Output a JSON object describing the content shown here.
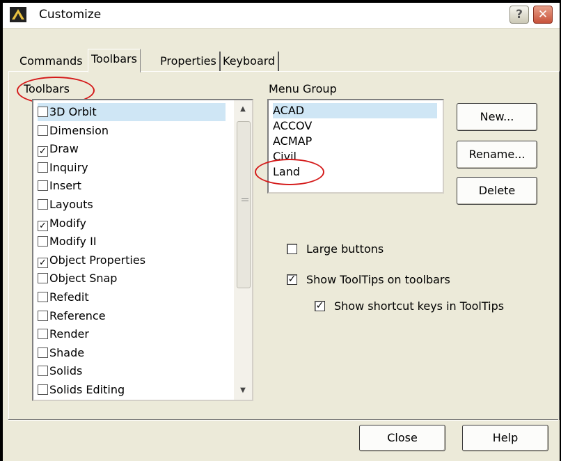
{
  "window": {
    "title": "Customize"
  },
  "tabs": [
    {
      "label": "Commands"
    },
    {
      "label": "Toolbars"
    },
    {
      "label": "Properties"
    },
    {
      "label": "Keyboard"
    }
  ],
  "toolbars": {
    "label": "Toolbars",
    "items": [
      {
        "label": "3D Orbit",
        "checked": false
      },
      {
        "label": "Dimension",
        "checked": false
      },
      {
        "label": "Draw",
        "checked": true
      },
      {
        "label": "Inquiry",
        "checked": false
      },
      {
        "label": "Insert",
        "checked": false
      },
      {
        "label": "Layouts",
        "checked": false
      },
      {
        "label": "Modify",
        "checked": true
      },
      {
        "label": "Modify II",
        "checked": false
      },
      {
        "label": "Object Properties",
        "checked": true
      },
      {
        "label": "Object Snap",
        "checked": false
      },
      {
        "label": "Refedit",
        "checked": false
      },
      {
        "label": "Reference",
        "checked": false
      },
      {
        "label": "Render",
        "checked": false
      },
      {
        "label": "Shade",
        "checked": false
      },
      {
        "label": "Solids",
        "checked": false
      },
      {
        "label": "Solids Editing",
        "checked": false
      }
    ]
  },
  "menu_group": {
    "label": "Menu Group",
    "items": [
      "ACAD",
      "ACCOV",
      "ACMAP",
      "Civil",
      "Land"
    ]
  },
  "buttons": {
    "new": "New...",
    "rename": "Rename...",
    "delete": "Delete",
    "close": "Close",
    "help": "Help"
  },
  "options": {
    "large_buttons": {
      "label": "Large buttons",
      "checked": false
    },
    "show_tooltips": {
      "label": "Show ToolTips on toolbars",
      "checked": true
    },
    "show_shortcut_keys": {
      "label": "Show shortcut keys in ToolTips",
      "checked": true
    }
  },
  "colors": {
    "annotation": "#d41a1a",
    "selection": "#cfe6f5",
    "dialog_bg": "#ecead9"
  }
}
